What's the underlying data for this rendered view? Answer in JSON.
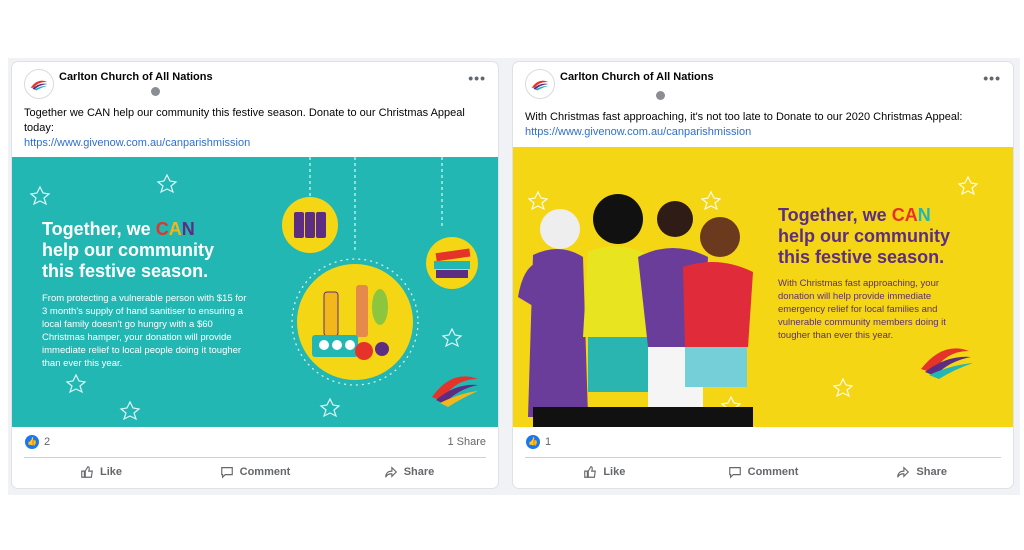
{
  "posts": [
    {
      "page_name": "Carlton Church of All Nations",
      "text": "Together we CAN help our community this festive season. Donate to our Christmas Appeal today:",
      "link": "https://www.givenow.com.au/canparishmission",
      "headline": {
        "pre": "Together, we ",
        "c": "C",
        "a": "A",
        "n": "N",
        "post": "help our community this festive season."
      },
      "subtext": "From protecting a vulnerable person with $15 for 3 month's supply of hand sanitiser to ensuring a local family doesn't go hungry with a $60 Christmas hamper, your donation will provide immediate relief to local people doing it tougher than ever this year.",
      "likes": "2",
      "shares": "1 Share",
      "actions": {
        "like": "Like",
        "comment": "Comment",
        "share": "Share"
      },
      "hero_color": "#23b7b3"
    },
    {
      "page_name": "Carlton Church of All Nations",
      "text": "With Christmas fast approaching, it's not too late to Donate to our 2020 Christmas Appeal:",
      "link": "https://www.givenow.com.au/canparishmission",
      "headline": {
        "pre": "Together, we ",
        "c": "C",
        "a": "A",
        "n": "N",
        "post": "help our community this festive season."
      },
      "subtext": "With Christmas fast approaching, your donation will help provide immediate emergency relief for local families and vulnerable community members doing it tougher than ever this year.",
      "likes": "1",
      "actions": {
        "like": "Like",
        "comment": "Comment",
        "share": "Share"
      },
      "hero_color": "#f5d614"
    }
  ],
  "icons": {
    "globe": "globe-icon",
    "more": "more-options-icon",
    "like": "thumbs-up-icon",
    "comment": "comment-icon",
    "share": "share-icon"
  }
}
